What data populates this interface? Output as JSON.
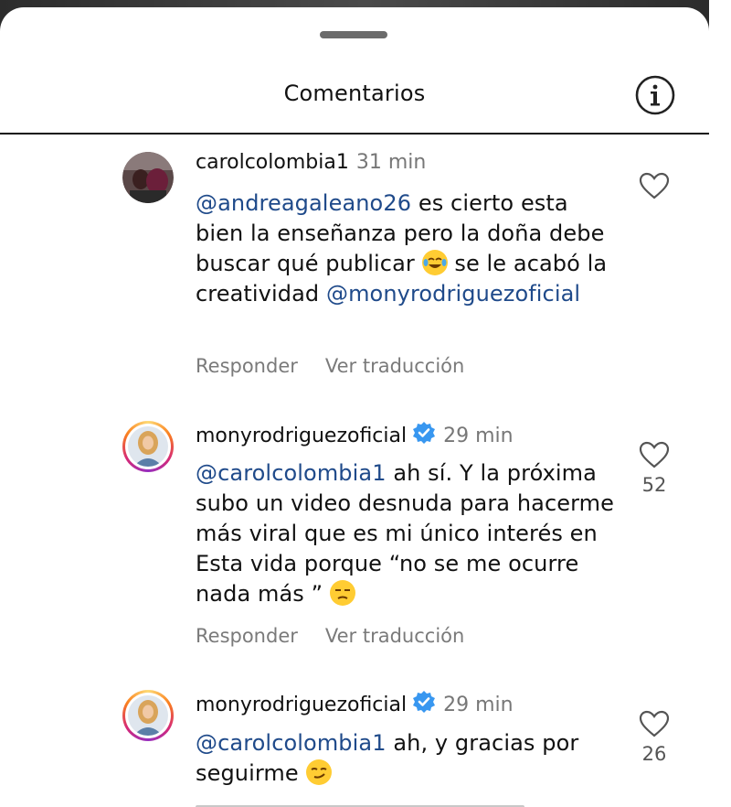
{
  "header": {
    "title": "Comentarios",
    "info_icon": "info-icon"
  },
  "comments": [
    {
      "username": "carolcolombia1",
      "verified": false,
      "time": "31 min",
      "text_parts": [
        "@andreagaleano26",
        " es cierto esta bien la enseñanza pero la doña debe buscar qué publicar ",
        " se le acabó la creatividad ",
        "@monyrodriguezoficial"
      ],
      "emoji": "tears-of-joy-emoji",
      "reply_label": "Responder",
      "translate_label": "Ver traducción",
      "likes": ""
    },
    {
      "username": "monyrodriguezoficial",
      "verified": true,
      "time": "29 min",
      "text_parts": [
        "@carolcolombia1",
        " ah sí. Y la próxima subo un video desnuda para hacerme más viral que es mi único interés en Esta vida porque “no se me ocurre nada más ” "
      ],
      "emoji": "unamused-face-emoji",
      "reply_label": "Responder",
      "translate_label": "Ver traducción",
      "likes": "52"
    },
    {
      "username": "monyrodriguezoficial",
      "verified": true,
      "time": "29 min",
      "text_parts": [
        "@carolcolombia1",
        " ah, y gracias por seguirme "
      ],
      "emoji": "smirking-face-emoji",
      "likes": "26"
    }
  ],
  "colors": {
    "mention": "#1f4a8a",
    "verified": "#3897f0",
    "secondary_text": "#7a7a7a"
  }
}
